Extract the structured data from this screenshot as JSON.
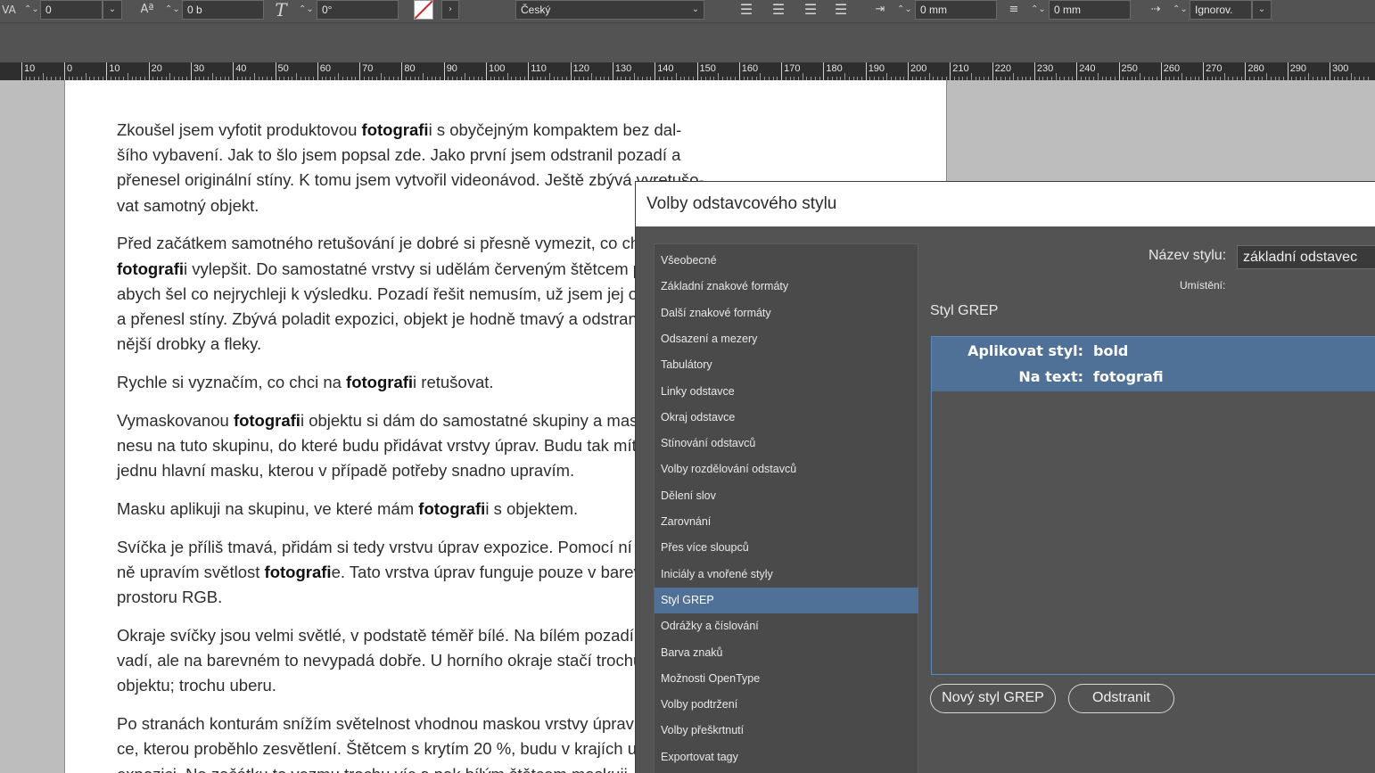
{
  "controlbar": {
    "tracking_value": "0",
    "baseline_shift_value": "0 b",
    "skew_value": "0°",
    "language": "Český",
    "left_indent": "0 mm",
    "space_after": "0 mm",
    "grid_align": "Ignorov."
  },
  "ruler": {
    "labels": [
      "10",
      "0",
      "10",
      "20",
      "30",
      "40",
      "50",
      "60",
      "70",
      "80",
      "90",
      "100",
      "110",
      "120",
      "130",
      "140",
      "150",
      "160",
      "170",
      "180",
      "190",
      "200",
      "210",
      "220",
      "230",
      "240",
      "250",
      "260",
      "270",
      "280",
      "290",
      "300"
    ]
  },
  "article": {
    "paragraphs": [
      [
        "Zkoušel jsem vyfotit produktovou ",
        "fotografi",
        "i s obyčejným kompaktem bez dal-",
        "\nšího vybavení. Jak to šlo jsem popsal zde. Jako první jsem odstranil pozadí a",
        "\npřenesel originální stíny. K tomu jsem vytvořil videonávod. Ještě zbývá vyretušo-",
        "\nvat samotný objekt."
      ],
      [
        "Před začátkem samotného retušování je dobré si přesně vymezit, co chci na",
        "\n",
        "fotografi",
        "i vylepšit. Do samostatné vrstvy si udělám červeným štětcem poznámky,",
        "\nabych šel co nejrychleji k výsledku. Pozadí řešit nemusím, už jsem jej odstranil",
        "\na přenesl stíny. Zbývá poladit expozici, objekt je hodně tmavý a odstranit drob-",
        "\nnější drobky a fleky."
      ],
      [
        "Rychle si vyznačím, co chci na ",
        "fotografi",
        "i retušovat."
      ],
      [
        "Vymaskovanou ",
        "fotografi",
        "i objektu si dám do samostatné skupiny a masku pře-",
        "\nnesu na tuto skupinu, do které budu přidávat vrstvy úprav. Budu tak mít jen",
        "\njednu hlavní masku, kterou v případě potřeby snadno upravím."
      ],
      [
        "Masku aplikuji na skupinu, ve které mám ",
        "fotografi",
        "i s objektem."
      ],
      [
        "Svíčka je příliš tmavá, přidám si tedy vrstvu úprav expozice. Pomocí ní celkově",
        "\nně upravím světlost ",
        "fotografi",
        "e. Tato vrstva úprav funguje pouze v barevném",
        "\nprostoru RGB."
      ],
      [
        "Okraje svíčky jsou velmi světlé, v podstatě téměř bílé. Na bílém pozadí to ne-",
        "\nvadí, ale na barevném to nevypadá dobře. U horního okraje stačí trochu ubrat",
        "\nobjektu; trochu uberu."
      ],
      [
        "Po stranách konturám snížím světelnost vhodnou maskou vrstvy úprav expozi-",
        "\nce, kterou proběhlo zesvětlení. Štětcem s krytím 20 %, budu v krajích ubírat",
        "\nexpozici. Na začátku to vezmu trochu víc a pak bílým štětcem maskuji."
      ]
    ]
  },
  "dialog": {
    "title": "Volby odstavcového stylu",
    "categories": [
      "Všeobecné",
      "Základní znakové formáty",
      "Další znakové formáty",
      "Odsazení a mezery",
      "Tabulátory",
      "Linky odstavce",
      "Okraj odstavce",
      "Stínování odstavců",
      "Volby rozdělování odstavců",
      "Dělení slov",
      "Zarovnání",
      "Přes více sloupců",
      "Iniciály a vnořené styly",
      "Styl GREP",
      "Odrážky a číslování",
      "Barva znaků",
      "Možnosti OpenType",
      "Volby podtržení",
      "Volby přeškrtnutí",
      "Exportovat tagy"
    ],
    "selected_category": "Styl GREP",
    "style_name_label": "Název stylu:",
    "style_name_value": "základní odstavec",
    "location_label": "Umístění:",
    "section_heading": "Styl GREP",
    "rule": {
      "apply_style_label": "Aplikovat styl:",
      "apply_style_value": "bold",
      "on_text_label": "Na text:",
      "on_text_value": "fotografi"
    },
    "new_grep_button": "Nový styl GREP",
    "delete_button": "Odstranit"
  },
  "colors": {
    "selection": "#4f7198",
    "ui_dark": "#535353",
    "page": "#ffffff"
  }
}
